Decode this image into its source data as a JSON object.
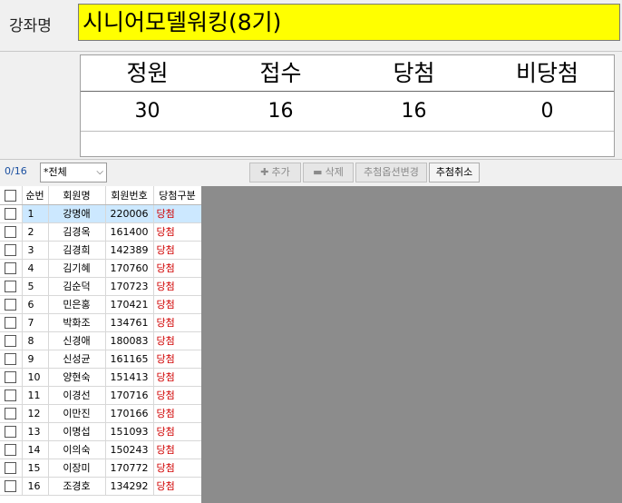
{
  "course": {
    "label": "강좌명",
    "name": "시니어모델워킹(8기)"
  },
  "stats": {
    "headers": [
      "정원",
      "접수",
      "당첨",
      "비당첨"
    ],
    "values": [
      "30",
      "16",
      "16",
      "0"
    ]
  },
  "toolbar": {
    "count": "0/16",
    "filter_value": "*전체",
    "add_label": "추가",
    "delete_label": "삭제",
    "change_option_label": "추첨옵션변경",
    "cancel_draw_label": "추첨취소"
  },
  "grid": {
    "columns": [
      "순번",
      "회원명",
      "회원번호",
      "당첨구분"
    ],
    "rows": [
      {
        "seq": "1",
        "name": "강명애",
        "member_no": "220006",
        "status": "당첨"
      },
      {
        "seq": "2",
        "name": "김경옥",
        "member_no": "161400",
        "status": "당첨"
      },
      {
        "seq": "3",
        "name": "김경희",
        "member_no": "142389",
        "status": "당첨"
      },
      {
        "seq": "4",
        "name": "김기혜",
        "member_no": "170760",
        "status": "당첨"
      },
      {
        "seq": "5",
        "name": "김순덕",
        "member_no": "170723",
        "status": "당첨"
      },
      {
        "seq": "6",
        "name": "민은홍",
        "member_no": "170421",
        "status": "당첨"
      },
      {
        "seq": "7",
        "name": "박화조",
        "member_no": "134761",
        "status": "당첨"
      },
      {
        "seq": "8",
        "name": "신경애",
        "member_no": "180083",
        "status": "당첨"
      },
      {
        "seq": "9",
        "name": "신성균",
        "member_no": "161165",
        "status": "당첨"
      },
      {
        "seq": "10",
        "name": "양현숙",
        "member_no": "151413",
        "status": "당첨"
      },
      {
        "seq": "11",
        "name": "이경선",
        "member_no": "170716",
        "status": "당첨"
      },
      {
        "seq": "12",
        "name": "이만진",
        "member_no": "170166",
        "status": "당첨"
      },
      {
        "seq": "13",
        "name": "이명섭",
        "member_no": "151093",
        "status": "당첨"
      },
      {
        "seq": "14",
        "name": "이의숙",
        "member_no": "150243",
        "status": "당첨"
      },
      {
        "seq": "15",
        "name": "이장미",
        "member_no": "170772",
        "status": "당첨"
      },
      {
        "seq": "16",
        "name": "조경호",
        "member_no": "134292",
        "status": "당첨"
      }
    ]
  },
  "colors": {
    "highlight": "#ffff00",
    "status_red": "#d00000",
    "selected_row": "#cce8ff",
    "empty_area": "#8c8c8c"
  }
}
